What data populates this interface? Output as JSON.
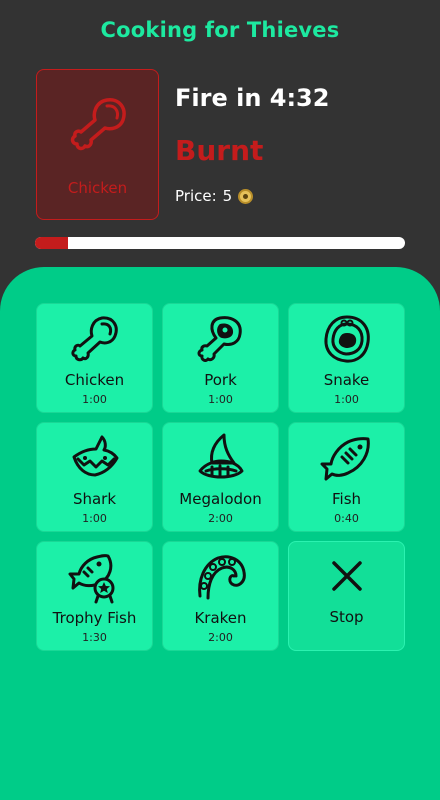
{
  "app": {
    "title": "Cooking for Thieves"
  },
  "current": {
    "item_label": "Chicken",
    "timer_text": "Fire in 4:32",
    "status_text": "Burnt",
    "price_label": "Price:",
    "price_value": "5",
    "progress_fraction": 0.09,
    "colors": {
      "status": "#c41c1c",
      "card_bg": "#5a2424"
    }
  },
  "menu": {
    "items": [
      {
        "name": "Chicken",
        "time": "1:00",
        "icon": "chicken-leg-icon"
      },
      {
        "name": "Pork",
        "time": "1:00",
        "icon": "pork-icon"
      },
      {
        "name": "Snake",
        "time": "1:00",
        "icon": "snake-icon"
      },
      {
        "name": "Shark",
        "time": "1:00",
        "icon": "shark-icon"
      },
      {
        "name": "Megalodon",
        "time": "2:00",
        "icon": "megalodon-fin-icon"
      },
      {
        "name": "Fish",
        "time": "0:40",
        "icon": "fish-icon"
      },
      {
        "name": "Trophy Fish",
        "time": "1:30",
        "icon": "trophy-fish-icon"
      },
      {
        "name": "Kraken",
        "time": "2:00",
        "icon": "kraken-tentacle-icon"
      }
    ],
    "stop": {
      "label": "Stop",
      "icon": "close-icon"
    }
  },
  "colors": {
    "accent": "#00cc88",
    "tile": "#1cf0a8",
    "background": "#333333",
    "title": "#1de9a0"
  }
}
